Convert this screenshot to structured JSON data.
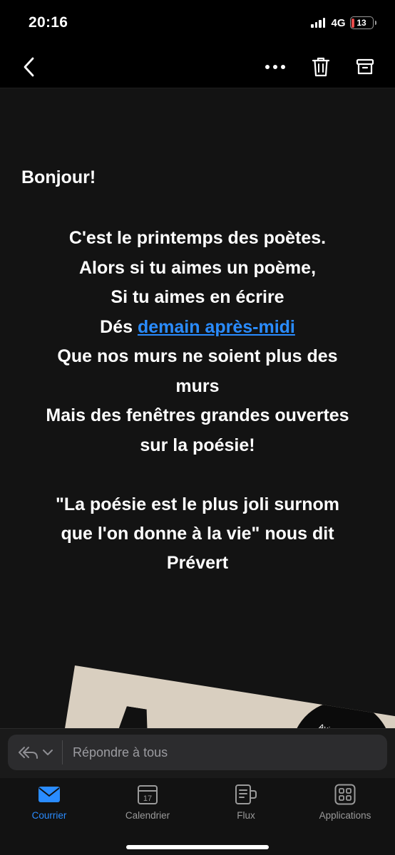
{
  "status_bar": {
    "time": "20:16",
    "network": "4G",
    "battery": "13",
    "battery_level": 0.13
  },
  "toolbar": {
    "back_icon": "chevron-left-icon",
    "more_icon": "more-horizontal-icon",
    "delete_icon": "trash-icon",
    "archive_icon": "archive-icon"
  },
  "email": {
    "greeting": "Bonjour!",
    "poem": {
      "line1": "C'est le printemps des poètes.",
      "line2": "Alors si tu aimes un poème,",
      "line3": "Si tu aimes en écrire",
      "line4_prefix": "Dés ",
      "line4_link": "demain après-midi",
      "line5": "Que nos murs ne soient plus des",
      "line6": "murs",
      "line7": "Mais des fenêtres grandes ouvertes",
      "line8": "sur la poésie!"
    },
    "quote": {
      "line1": "\"La poésie est le plus joli surnom",
      "line2": "que l'on donne à la vie\" nous dit",
      "line3": "Prévert"
    },
    "attachment_text": {
      "line1": "Avis",
      "line2": "les"
    }
  },
  "reply": {
    "placeholder": "Répondre à tous",
    "icon": "reply-all-icon"
  },
  "tabs": [
    {
      "label": "Courrier",
      "icon": "mail-icon",
      "active": true
    },
    {
      "label": "Calendrier",
      "icon": "calendar-icon",
      "active": false,
      "badge": "17"
    },
    {
      "label": "Flux",
      "icon": "feed-icon",
      "active": false
    },
    {
      "label": "Applications",
      "icon": "apps-grid-icon",
      "active": false
    }
  ],
  "colors": {
    "accent": "#2a8cff",
    "background": "#131313",
    "battery_low": "#e84a4a"
  }
}
